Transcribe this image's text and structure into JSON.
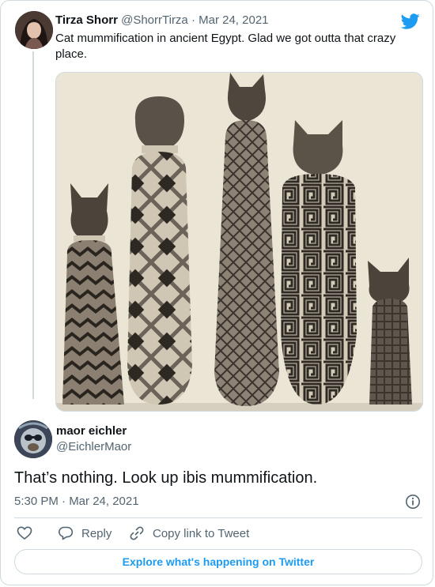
{
  "parent_tweet": {
    "name": "Tirza Shorr",
    "handle": "@ShorrTirza",
    "separator": "·",
    "date": "Mar 24, 2021",
    "text": "Cat mummification in ancient Egypt. Glad we got outta that crazy place."
  },
  "reply_tweet": {
    "name": "maor eichler",
    "handle": "@EichlerMaor",
    "text": "That’s nothing. Look up ibis mummification.",
    "timestamp": "5:30 PM · Mar 24, 2021"
  },
  "actions": {
    "like_label": "",
    "reply_label": "Reply",
    "copy_label": "Copy link to Tweet"
  },
  "explore": {
    "label": "Explore what's happening on Twitter"
  },
  "colors": {
    "accent": "#1d9bf0",
    "text_primary": "#0f1419",
    "text_secondary": "#536471",
    "border": "#cfd9de"
  },
  "icons": [
    "twitter-bird-icon",
    "heart-icon",
    "reply-bubble-icon",
    "link-icon",
    "info-icon"
  ]
}
